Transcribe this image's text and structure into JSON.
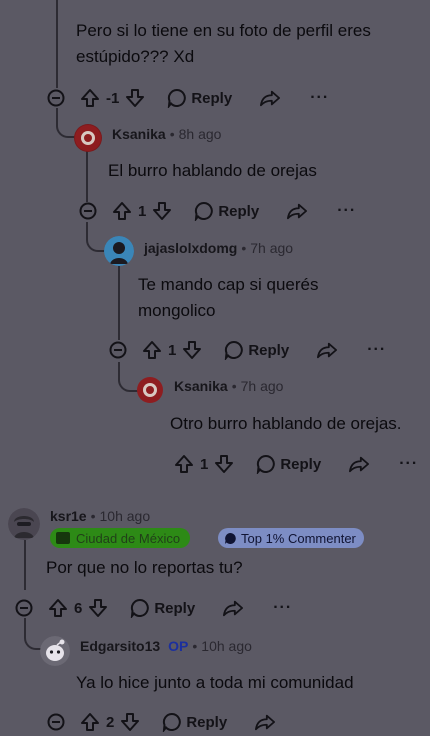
{
  "colors": {
    "background": "#5b5964",
    "text": "#0b0a0e",
    "location_badge": "#2d8a16",
    "commenter_badge": "#7d8dc4",
    "op_label": "#1b2f9e"
  },
  "comments": [
    {
      "text_lines": [
        "Pero si lo tiene en su foto de perfil eres",
        "estúpido??? Xd"
      ],
      "score": "-1",
      "reply_label": "Reply",
      "more_label": "···"
    },
    {
      "username": "Ksanika",
      "separator": "•",
      "time": "8h ago",
      "text": "El burro hablando de orejas",
      "score": "1",
      "reply_label": "Reply",
      "more_label": "···"
    },
    {
      "username": "jajaslolxdomg",
      "separator": "•",
      "time": "7h ago",
      "text_lines": [
        "Te mando cap si querés",
        "mongolico"
      ],
      "score": "1",
      "reply_label": "Reply",
      "more_label": "···"
    },
    {
      "username": "Ksanika",
      "separator": "•",
      "time": "7h ago",
      "text": "Otro burro hablando de orejas.",
      "score": "1",
      "reply_label": "Reply",
      "more_label": "···"
    },
    {
      "username": "ksr1e",
      "separator": "•",
      "time": "10h ago",
      "badges": {
        "location": "Ciudad de México",
        "commenter": "Top 1% Commenter"
      },
      "text": "Por que no lo reportas tu?",
      "score": "6",
      "reply_label": "Reply",
      "more_label": "···"
    },
    {
      "username": "Edgarsito13",
      "op_label": "OP",
      "separator": "•",
      "time": "10h ago",
      "text": "Ya lo hice junto a toda mi comunidad",
      "score": "2",
      "reply_label": "Reply"
    }
  ]
}
